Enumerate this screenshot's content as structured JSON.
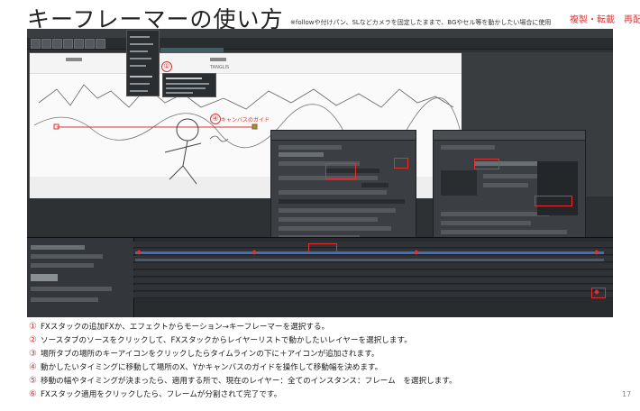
{
  "title": "キーフレーマーの使い方",
  "subtitle": "※followや付けパン、SLなどカメラを固定したままで、BGやセル等を動かしたい場合に使用",
  "copyright": "複製・転載　再配",
  "annotations": {
    "marker_1": "①",
    "marker_4": "④",
    "guide_label": "キャンバスのガイド"
  },
  "canvas": {
    "logo_text": "TANGLIS"
  },
  "steps": [
    {
      "num": "①",
      "text": "FXスタックの追加FXか、エフェクトからモーション→キーフレーマーを選択する。"
    },
    {
      "num": "②",
      "text": "ソースタブのソースをクリックして、FXスタックからレイヤーリストで動かしたいレイヤーを選択します。"
    },
    {
      "num": "③",
      "text": "場所タブの場所のキーアイコンをクリックしたらタイムラインの下に＋アイコンが追加されます。"
    },
    {
      "num": "④",
      "text": "動かしたいタイミングに移動して場所のX、Yかキャンバスのガイドを操作して移動幅を決めます。"
    },
    {
      "num": "⑤",
      "text": "移動の幅やタイミングが決まったら、適用する所で、現在のレイヤー：全てのインスタンス：フレーム　を選択します。"
    },
    {
      "num": "⑥",
      "text": "FXスタック適用をクリックしたら、フレームが分割されて完了です。"
    }
  ],
  "page_number": "17",
  "colors": {
    "accent_red": "#e03030",
    "app_background": "#2e3134",
    "panel_background": "#3b3e42"
  }
}
